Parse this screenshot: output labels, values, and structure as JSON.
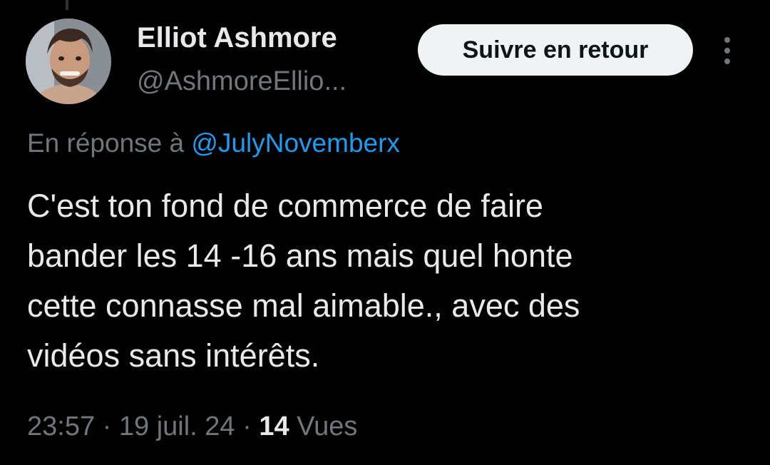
{
  "author": {
    "name": "Elliot Ashmore",
    "handle": "@AshmoreEllio..."
  },
  "follow_button": {
    "label": "Suivre en retour"
  },
  "more_icon": "more-vertical-icon",
  "reply": {
    "prefix": "En réponse à ",
    "mention": "@JulyNovemberx"
  },
  "tweet": {
    "text": "C'est ton fond de commerce de faire\nbander les 14 -16 ans mais quel honte\ncette connasse mal aimable., avec des\nvidéos sans intérêts."
  },
  "meta": {
    "time": "23:57",
    "separator": " · ",
    "date": "19 juil. 24",
    "views_count": "14",
    "views_label": " Vues"
  },
  "colors": {
    "background": "#000000",
    "text_primary": "#e7e9ea",
    "text_secondary": "#71767b",
    "link": "#1d9bf0",
    "button_bg": "#eff3f4",
    "button_text": "#0f1419"
  }
}
